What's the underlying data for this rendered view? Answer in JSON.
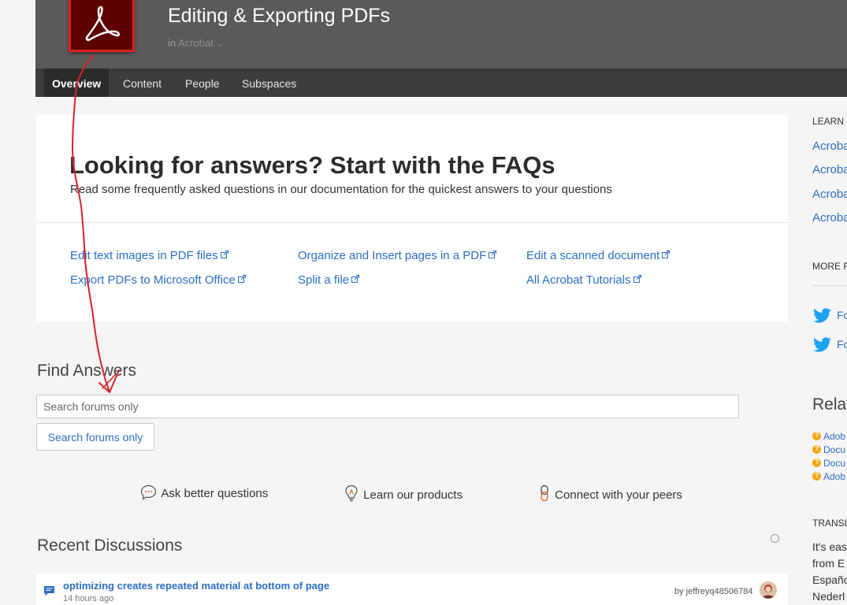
{
  "header": {
    "title": "Editing & Exporting PDFs",
    "parent_prefix": "in",
    "parent_name": "Acrobat",
    "parent_chevron": "⌵"
  },
  "nav": {
    "tabs": [
      {
        "label": "Overview"
      },
      {
        "label": "Content"
      },
      {
        "label": "People"
      },
      {
        "label": "Subspaces"
      }
    ]
  },
  "faq": {
    "title": "Looking for answers? Start with the FAQs",
    "subtitle": "Read some frequently asked questions in our documentation for the quickest answers to your questions",
    "links": [
      {
        "label": "Edit text images in PDF files"
      },
      {
        "label": "Export PDFs to Microsoft Office"
      },
      {
        "label": "Organize and Insert pages in a PDF"
      },
      {
        "label": "Split a file"
      },
      {
        "label": "Edit a scanned document"
      },
      {
        "label": "All Acrobat Tutorials"
      }
    ]
  },
  "find": {
    "title": "Find Answers",
    "search_placeholder": "Search forums only",
    "search_button": "Search forums only"
  },
  "features": {
    "ask": "Ask better questions",
    "learn": "Learn our products",
    "connect": "Connect with your peers"
  },
  "recent": {
    "title": "Recent Discussions",
    "items": [
      {
        "title": "optimizing creates repeated material at bottom of page",
        "time": "14 hours ago",
        "author": "by jeffreyq48506784"
      }
    ]
  },
  "sidebar": {
    "learn_heading": "LEARN",
    "learn_links": [
      "Acroba",
      "Acroba",
      "Acroba",
      "Acroba"
    ],
    "more_heading": "MORE R",
    "twitter_links": [
      "Fo",
      "Fo"
    ],
    "related_title": "Relat",
    "related_items": [
      "Adob",
      "Docu",
      "Docu",
      "Adob"
    ],
    "translate_heading": "TRANSLA",
    "translate_lines": [
      "It's eas",
      "from E",
      "Españo",
      "Nederl"
    ]
  },
  "colors": {
    "link": "#2d6ec2",
    "header_bg": "#5a5a5a",
    "nav_bg": "#3c3c3c",
    "acrobat_red": "#e01e24",
    "annotation_red": "#d8232a"
  }
}
